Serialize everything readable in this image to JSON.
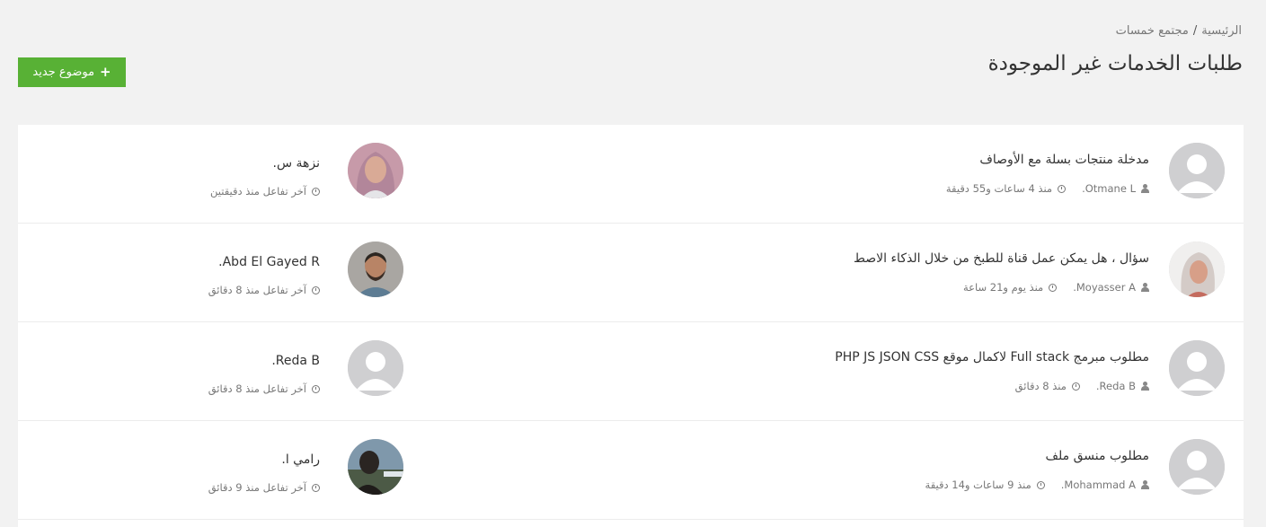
{
  "breadcrumb": {
    "home": "الرئيسية",
    "separator": "/",
    "section": "مجتمع خمسات"
  },
  "page_title": "طلبات الخدمات غير الموجودة",
  "new_topic_label": "موضوع جديد",
  "topics": [
    {
      "title": "مدخلة منتجات بسلة مع الأوصاف",
      "author": "Otmane L.",
      "time": "منذ 4 ساعات و55 دقيقة",
      "avatar": "default",
      "last_user": "نزهة س.",
      "last_time": "آخر تفاعل منذ دقيقتين",
      "last_avatar": "woman-hijab"
    },
    {
      "title": "سؤال ، هل يمكن عمل قناة للطبخ من خلال الذكاء الاصط",
      "author": "Moyasser A.",
      "time": "منذ يوم و21 ساعة",
      "avatar": "woman-photo",
      "last_user": "Abd El Gayed R.",
      "last_time": "آخر تفاعل منذ 8 دقائق",
      "last_avatar": "man-beard"
    },
    {
      "title": "مطلوب مبرمج Full stack لاكمال موقع PHP JS JSON CSS",
      "author": "Reda B.",
      "time": "منذ 8 دقائق",
      "avatar": "default",
      "last_user": "Reda B.",
      "last_time": "آخر تفاعل منذ 8 دقائق",
      "last_avatar": "default"
    },
    {
      "title": "مطلوب منسق ملف",
      "author": "Mohammad A.",
      "time": "منذ 9 ساعات و14 دقيقة",
      "avatar": "default",
      "last_user": "رامي ا.",
      "last_time": "آخر تفاعل منذ 9 دقائق",
      "last_avatar": "man-outdoor"
    }
  ],
  "colors": {
    "accent_green": "#58b135",
    "background": "#f2f2f2"
  }
}
